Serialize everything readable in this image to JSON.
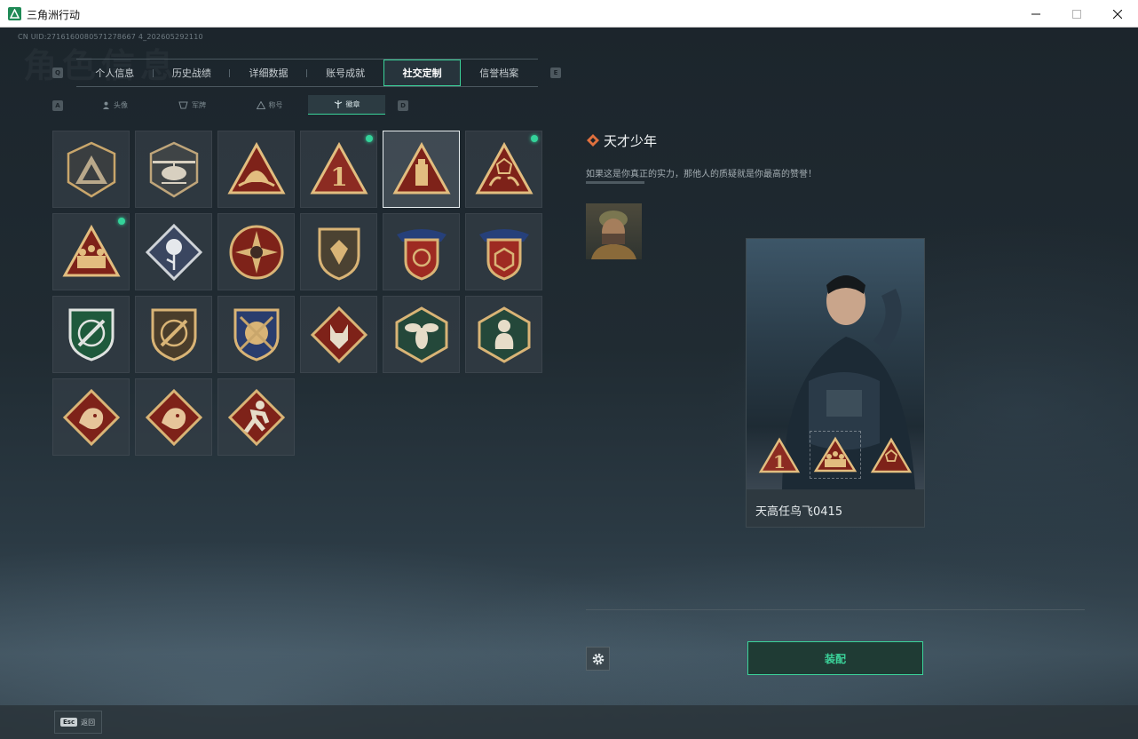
{
  "window": {
    "title": "三角洲行动"
  },
  "header": {
    "uid": "CN UID:2716160080571278667 4_202605292110",
    "bg_title": "角色信息"
  },
  "main_tabs": [
    {
      "label": "个人信息",
      "active": false
    },
    {
      "label": "历史战绩",
      "active": false
    },
    {
      "label": "详细数据",
      "active": false
    },
    {
      "label": "账号成就",
      "active": false
    },
    {
      "label": "社交定制",
      "active": true
    },
    {
      "label": "信誉档案",
      "active": false
    }
  ],
  "key_hints": {
    "prev_tab": "Q",
    "next_tab": "E",
    "prev_sub": "A",
    "next_sub": "D"
  },
  "sub_tabs": [
    {
      "label": "头像",
      "icon": "person-icon",
      "active": false
    },
    {
      "label": "军牌",
      "icon": "dogtag-icon",
      "active": false
    },
    {
      "label": "称号",
      "icon": "title-icon",
      "active": false
    },
    {
      "label": "徽章",
      "icon": "badge-icon",
      "active": true
    }
  ],
  "badges": [
    {
      "icon": "triangle-mountain-badge-icon",
      "new": false,
      "selected": false
    },
    {
      "icon": "helicopter-badge-icon",
      "new": false,
      "selected": false
    },
    {
      "icon": "dome-triangle-badge-icon",
      "new": false,
      "selected": false
    },
    {
      "icon": "number-one-triangle-badge-icon",
      "new": true,
      "selected": false
    },
    {
      "icon": "usb-triangle-badge-icon",
      "new": false,
      "selected": true
    },
    {
      "icon": "hands-triangle-badge-icon",
      "new": true,
      "selected": false
    },
    {
      "icon": "squad-triangle-badge-icon",
      "new": true,
      "selected": false
    },
    {
      "icon": "rose-diamond-badge-icon",
      "new": false,
      "selected": false
    },
    {
      "icon": "compass-star-badge-icon",
      "new": false,
      "selected": false
    },
    {
      "icon": "shield-emblem-badge-icon",
      "new": false,
      "selected": false
    },
    {
      "icon": "eagle-shield-red-badge-icon",
      "new": false,
      "selected": false
    },
    {
      "icon": "eagle-shield-cube-badge-icon",
      "new": false,
      "selected": false
    },
    {
      "icon": "green-rifle-crest-badge-icon",
      "new": false,
      "selected": false
    },
    {
      "icon": "rifle-circle-badge-icon",
      "new": false,
      "selected": false
    },
    {
      "icon": "crossed-blades-crest-badge-icon",
      "new": false,
      "selected": false
    },
    {
      "icon": "wolf-diamond-badge-icon",
      "new": false,
      "selected": false
    },
    {
      "icon": "hornet-hexagon-badge-icon",
      "new": false,
      "selected": false
    },
    {
      "icon": "monkey-hexagon-badge-icon",
      "new": false,
      "selected": false
    },
    {
      "icon": "dragon-diamond-badge-icon",
      "new": false,
      "selected": false
    },
    {
      "icon": "dragon-diamond-2-badge-icon",
      "new": false,
      "selected": false
    },
    {
      "icon": "runner-diamond-badge-icon",
      "new": false,
      "selected": false
    }
  ],
  "detail": {
    "title": "天才少年",
    "description": "如果这是你真正的实力，那他人的质疑就是你最高的赞誉！"
  },
  "card": {
    "player_name": "天高任鸟飞0415"
  },
  "actions": {
    "equip_label": "装配",
    "back_key": "Esc",
    "back_label": "返回"
  },
  "colors": {
    "accent": "#3bd39a",
    "badge_gold": "#d9b476",
    "badge_red": "#8c2b22"
  }
}
